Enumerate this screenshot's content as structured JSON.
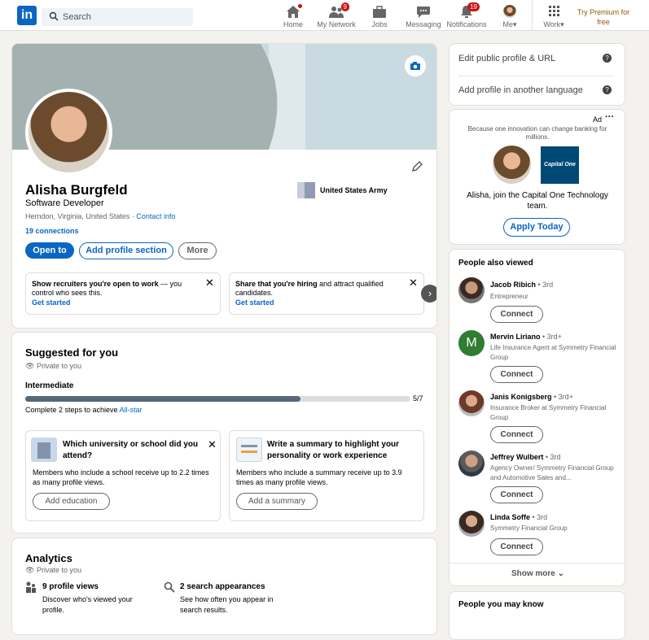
{
  "nav": {
    "search_placeholder": "Search",
    "items": [
      {
        "label": "Home"
      },
      {
        "label": "My Network",
        "badge": "9"
      },
      {
        "label": "Jobs"
      },
      {
        "label": "Messaging"
      },
      {
        "label": "Notifications",
        "badge": "19"
      },
      {
        "label": "Me"
      },
      {
        "label": "Work"
      }
    ],
    "premium": "Try Premium for free"
  },
  "profile": {
    "name": "Alisha Burgfeld",
    "headline": "Software Developer",
    "location": "Herndon, Virginia, United States",
    "contact_info": "Contact info",
    "connections": "19 connections",
    "employer": "United States Army",
    "sep": " · "
  },
  "actions": {
    "open_to": "Open to",
    "add_section": "Add profile section",
    "more": "More"
  },
  "promos": [
    {
      "bold": "Show recruiters you're open to work",
      "text": " — you control who sees this.",
      "cta": "Get started"
    },
    {
      "bold": "Share that you're hiring",
      "text": " and attract qualified candidates.",
      "cta": "Get started"
    }
  ],
  "suggested": {
    "title": "Suggested for you",
    "private": "Private to you",
    "level": "Intermediate",
    "progress_label": "5/7",
    "progress": 0.714,
    "hint": "Complete 2 steps to achieve ",
    "hint_link": "All-star",
    "cards": [
      {
        "title": "Which university or school did you attend?",
        "text": "Members who include a school receive up to 2.2 times as many profile views.",
        "button": "Add education"
      },
      {
        "title": "Write a summary to highlight your personality or work experience",
        "text": "Members who include a summary receive up to 3.9 times as many profile views.",
        "button": "Add a summary"
      }
    ]
  },
  "analytics": {
    "title": "Analytics",
    "private": "Private to you",
    "items": [
      {
        "title": "9 profile views",
        "text": "Discover who's viewed your profile."
      },
      {
        "title": "2 search appearances",
        "text": "See how often you appear in search results."
      }
    ]
  },
  "side": {
    "edit_url": "Edit public profile & URL",
    "add_lang": "Add profile in another language"
  },
  "ad": {
    "label": "Ad",
    "tagline": "Because one innovation can change banking for millions.",
    "logo_text": "Capital One",
    "message": "Alisha, join the Capital One Technology team.",
    "cta": "Apply Today"
  },
  "people_viewed": {
    "title": "People also viewed",
    "connect": "Connect",
    "show_more": "Show more",
    "people": [
      {
        "name": "Jacob Ribich",
        "degree": " • 3rd",
        "title": "Entrepreneur"
      },
      {
        "name": "Mervin Liriano",
        "degree": " • 3rd+",
        "title": "Life Insurance Agent at Symmetry Financial Group",
        "initial": "M"
      },
      {
        "name": "Janis Konigsberg",
        "degree": " • 3rd+",
        "title": "Insurance Broker at Symmetry Financial Group"
      },
      {
        "name": "Jeffrey Wulbert",
        "degree": " • 3rd",
        "title": "Agency Owner/ Symmetry Financial Group and Automotive Sales and..."
      },
      {
        "name": "Linda Soffe",
        "degree": " • 3rd",
        "title": "Symmetry Financial Group"
      }
    ]
  },
  "may_know": {
    "title": "People you may know"
  },
  "colors": {
    "accent": "#0a66c2",
    "badge": "#cc1016",
    "premium": "#915907"
  }
}
